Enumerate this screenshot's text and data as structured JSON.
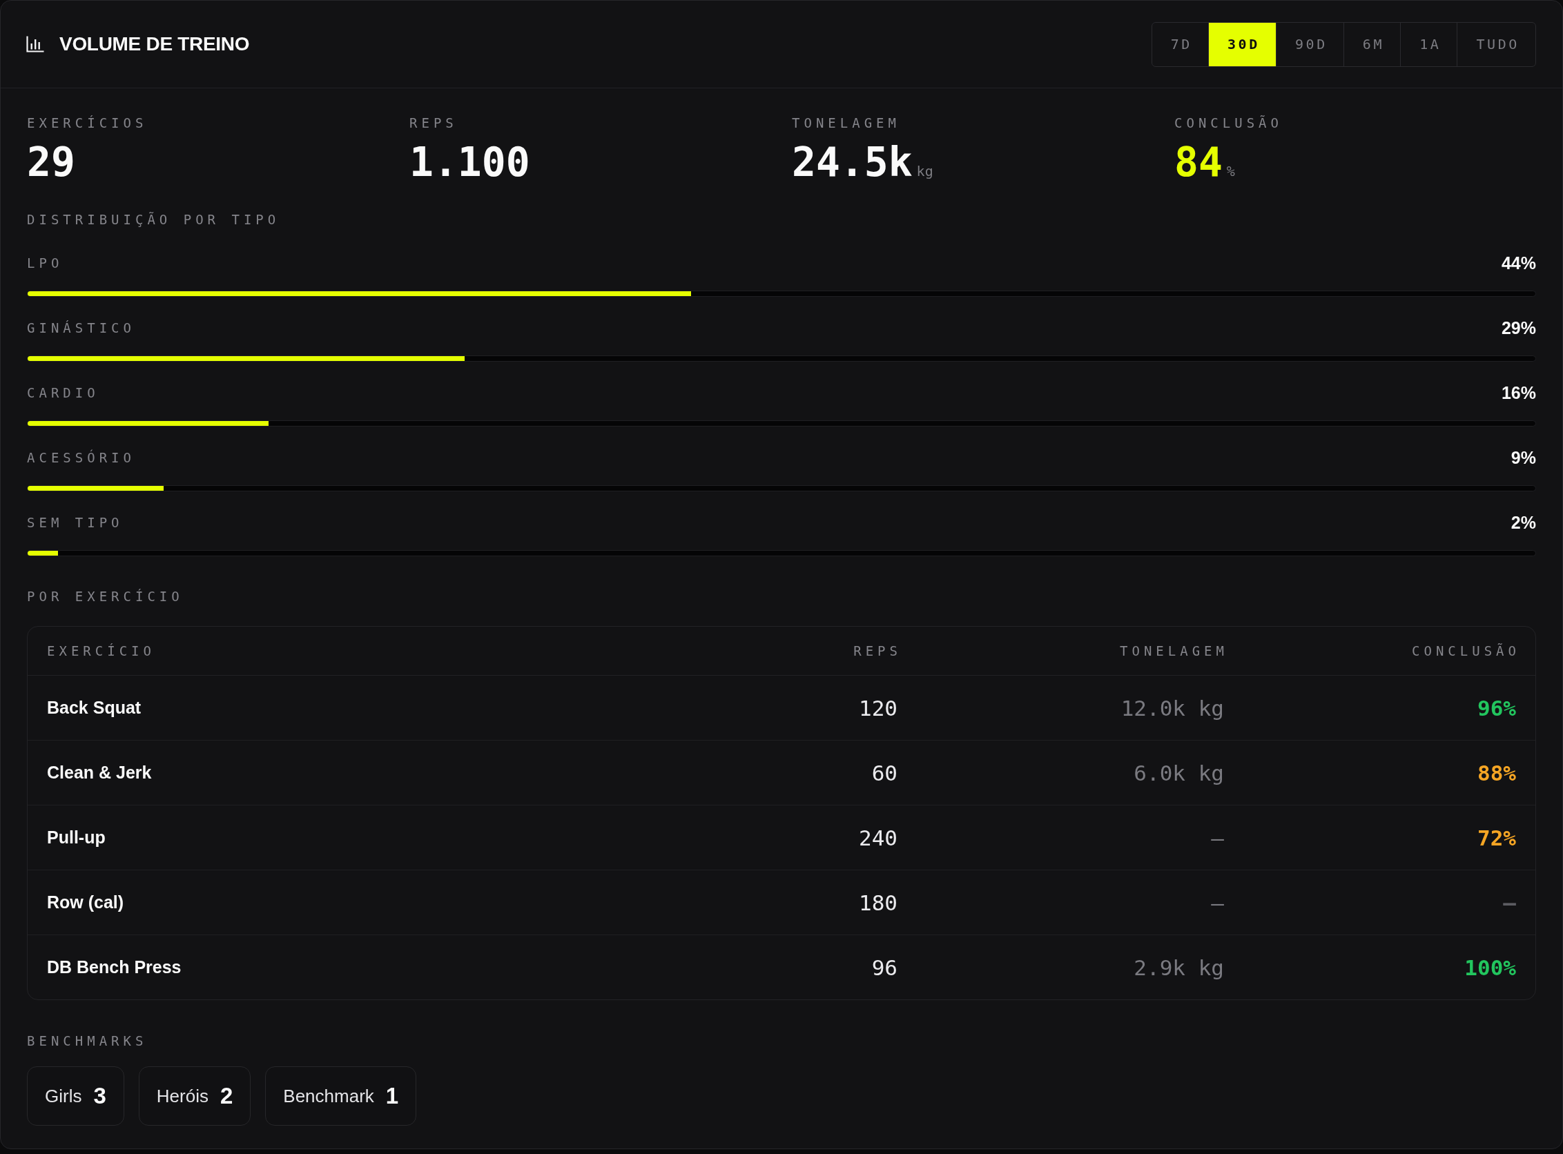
{
  "header": {
    "title": "VOLUME DE TREINO",
    "periods": [
      {
        "label": "7D",
        "selected": false
      },
      {
        "label": "30D",
        "selected": true
      },
      {
        "label": "90D",
        "selected": false
      },
      {
        "label": "6M",
        "selected": false
      },
      {
        "label": "1A",
        "selected": false
      },
      {
        "label": "TUDO",
        "selected": false
      }
    ]
  },
  "stats": [
    {
      "label": "EXERCÍCIOS",
      "value": "29",
      "highlighted": false
    },
    {
      "label": "REPS",
      "value": "1.100",
      "highlighted": false
    },
    {
      "label": "TONELAGEM",
      "value": "24.5k",
      "unit": "kg",
      "highlighted": false
    },
    {
      "label": "CONCLUSÃO",
      "value": "84",
      "unit": "%",
      "highlighted": true
    }
  ],
  "distribution": {
    "title": "DISTRIBUIÇÃO POR TIPO",
    "types": [
      {
        "label": "LPO",
        "percent": "44%",
        "level": 0.44
      },
      {
        "label": "GINÁSTICO",
        "percent": "29%",
        "level": 0.29
      },
      {
        "label": "CARDIO",
        "percent": "16%",
        "level": 0.16
      },
      {
        "label": "ACESSÓRIO",
        "percent": "9%",
        "level": 0.09
      },
      {
        "label": "SEM TIPO",
        "percent": "2%",
        "level": 0.02
      }
    ]
  },
  "exercises": {
    "title": "POR EXERCÍCIO",
    "columns": [
      "EXERCÍCIO",
      "REPS",
      "TONELAGEM",
      "CONCLUSÃO"
    ],
    "rows": [
      {
        "name": "Back Squat",
        "reps": "120",
        "tonnage": "12.0k kg",
        "conclusion": "96%",
        "color": "#22c55e"
      },
      {
        "name": "Clean & Jerk",
        "reps": "60",
        "tonnage": "6.0k kg",
        "conclusion": "88%",
        "color": "#f5a524"
      },
      {
        "name": "Pull-up",
        "reps": "240",
        "tonnage": "—",
        "conclusion": "72%",
        "color": "#f5a524"
      },
      {
        "name": "Row (cal)",
        "reps": "180",
        "tonnage": "—",
        "conclusion": "—",
        "color": "#5c5c62"
      },
      {
        "name": "DB Bench Press",
        "reps": "96",
        "tonnage": "2.9k kg",
        "conclusion": "100%",
        "color": "#22c55e"
      }
    ]
  },
  "benchmarks": {
    "title": "BENCHMARKS",
    "groups": [
      {
        "label": "Girls",
        "count": "3"
      },
      {
        "label": "Heróis",
        "count": "2"
      },
      {
        "label": "Benchmark",
        "count": "1"
      }
    ]
  }
}
